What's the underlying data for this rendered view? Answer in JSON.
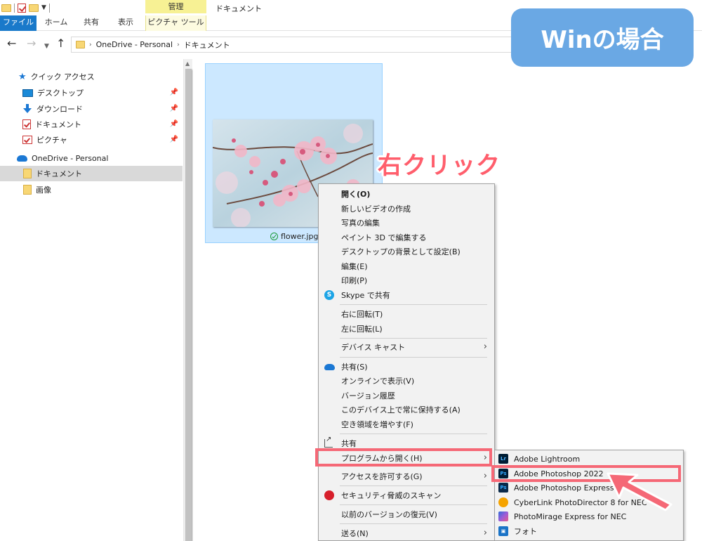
{
  "window": {
    "title": "ドキュメント",
    "manage_tab": "管理",
    "ribbon_tabs": [
      "ファイル",
      "ホーム",
      "共有",
      "表示",
      "ピクチャ ツール"
    ]
  },
  "address": {
    "crumbs": [
      "OneDrive - Personal",
      "ドキュメント"
    ]
  },
  "sidebar": {
    "items": [
      {
        "label": "クイック アクセス",
        "icon": "star-icon"
      },
      {
        "label": "デスクトップ",
        "icon": "desktop-icon",
        "pinned": true
      },
      {
        "label": "ダウンロード",
        "icon": "download-icon",
        "pinned": true
      },
      {
        "label": "ドキュメント",
        "icon": "documents-icon",
        "pinned": true
      },
      {
        "label": "ピクチャ",
        "icon": "pictures-icon",
        "pinned": true
      },
      {
        "label": "OneDrive - Personal",
        "icon": "onedrive-icon"
      },
      {
        "label": "ドキュメント",
        "icon": "folder-icon",
        "selected": true
      },
      {
        "label": "画像",
        "icon": "folder-icon"
      }
    ]
  },
  "file": {
    "name": "flower.jpg",
    "status_icon": "sync-ok-icon"
  },
  "annotations": {
    "badge": "Winの場合",
    "callout": "右クリック",
    "highlight_color": "#f56876",
    "badge_color": "#6aa8e4"
  },
  "context_menu": {
    "items": [
      "開く(O)",
      "新しいビデオの作成",
      "写真の編集",
      "ペイント 3D で編集する",
      "デスクトップの背景として設定(B)",
      "編集(E)",
      "印刷(P)",
      "Skype で共有",
      "右に回転(T)",
      "左に回転(L)",
      "デバイス キャスト",
      "共有(S)",
      "オンラインで表示(V)",
      "バージョン履歴",
      "このデバイス上で常に保持する(A)",
      "空き領域を増やす(F)",
      "共有",
      "プログラムから開く(H)",
      "アクセスを許可する(G)",
      "セキュリティ脅威のスキャン",
      "以前のバージョンの復元(V)",
      "送る(N)"
    ]
  },
  "submenu": {
    "items": [
      {
        "label": "Adobe Lightroom",
        "icon": "Lr"
      },
      {
        "label": "Adobe Photoshop 2022",
        "icon": "Ps"
      },
      {
        "label": "Adobe Photoshop Express",
        "icon": "Ps"
      },
      {
        "label": "CyberLink PhotoDirector 8 for NEC",
        "icon": "PD"
      },
      {
        "label": "PhotoMirage Express for NEC",
        "icon": "PM"
      },
      {
        "label": "フォト",
        "icon": "photos"
      }
    ]
  }
}
